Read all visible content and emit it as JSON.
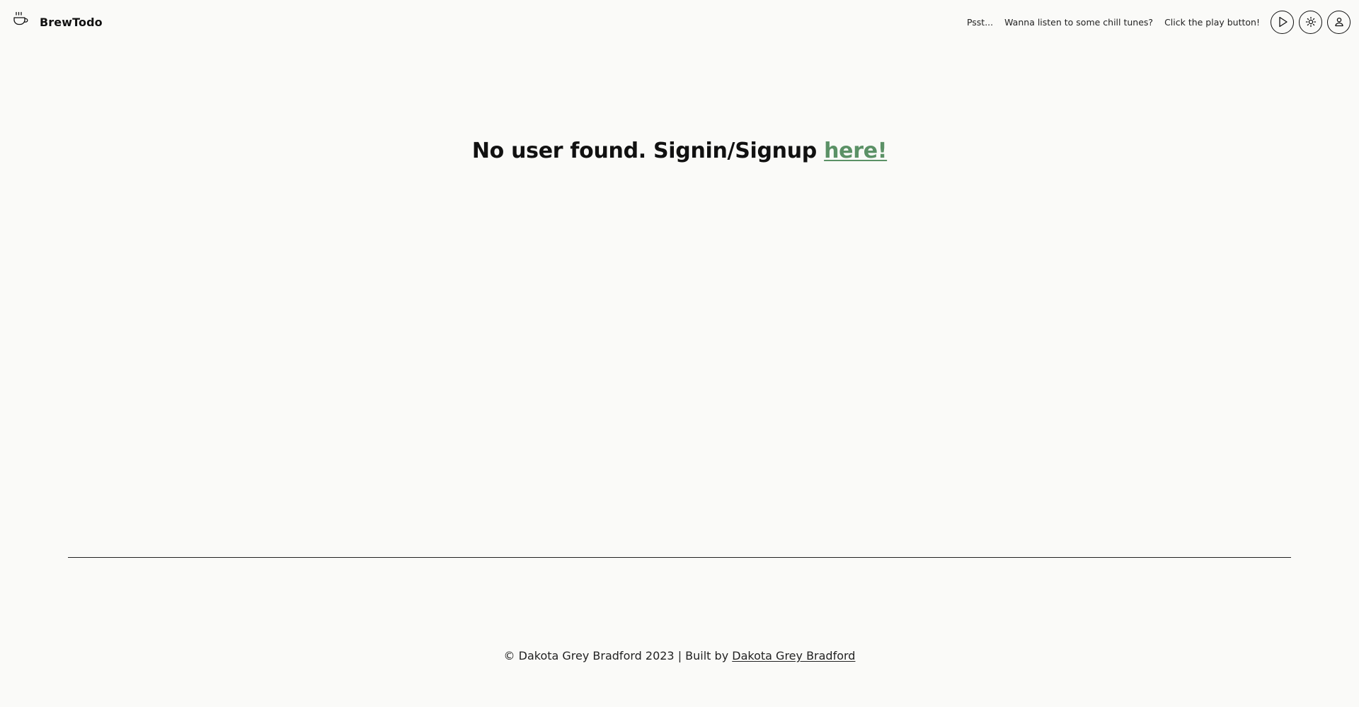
{
  "header": {
    "brand_title": "BrewTodo",
    "brand_icon": "coffee-cup-icon",
    "tips": [
      "Psst...",
      "Wanna listen to some chill tunes?",
      "Click the play button!"
    ],
    "buttons": {
      "play_icon": "play-icon",
      "theme_icon": "sun-icon",
      "user_icon": "user-icon"
    }
  },
  "main": {
    "message": "No user found. Signin/Signup",
    "link_label": "here!"
  },
  "footer": {
    "copyright": "© Dakota Grey Bradford 2023 | Built by",
    "author_link": "Dakota Grey Bradford"
  },
  "colors": {
    "background": "#fafaf8",
    "text": "#111111",
    "accent_link": "#5b9166"
  }
}
